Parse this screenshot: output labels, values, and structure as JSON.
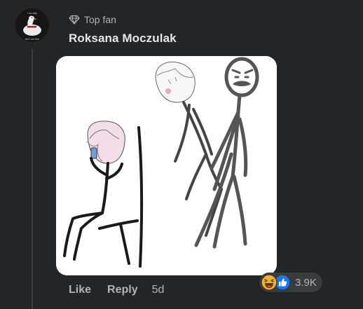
{
  "comment": {
    "badge": {
      "icon": "diamond-icon",
      "label": "Top fan"
    },
    "author": "Roksana Moczulak",
    "avatar": {
      "caption_top": "i no ally",
      "caption_bottom": "but I am fine"
    },
    "attachment": {
      "type": "stick-figure-drawing"
    },
    "actions": {
      "like_label": "Like",
      "reply_label": "Reply",
      "time": "5d"
    },
    "reactions": {
      "icons": [
        "haha-icon",
        "like-icon"
      ],
      "count": "3.9K"
    }
  },
  "colors": {
    "background": "#242526",
    "primary_text": "#e4e6eb",
    "secondary_text": "#b0b3b8",
    "reaction_pill": "#3a3b3c",
    "like_blue": "#1877f2",
    "haha_yellow": "#f7b125"
  }
}
